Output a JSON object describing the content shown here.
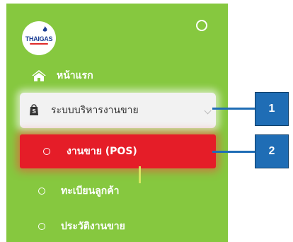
{
  "logo": {
    "text_main": "THAI",
    "text_accent": "GAS"
  },
  "menu": {
    "home_label": "หน้าแรก",
    "pos_group_label": "ระบบบริหารงานขาย",
    "active_label": "งานขาย (POS)",
    "customer_label": "ทะเบียนลูกค้า",
    "history_label": "ประวัติงานขาย"
  },
  "callouts": {
    "one": "1",
    "two": "2"
  },
  "colors": {
    "sidebar_bg": "#86c83f",
    "active_bg": "#e51d28",
    "group_bg": "#f2f2f2",
    "callout": "#1f6db5"
  }
}
